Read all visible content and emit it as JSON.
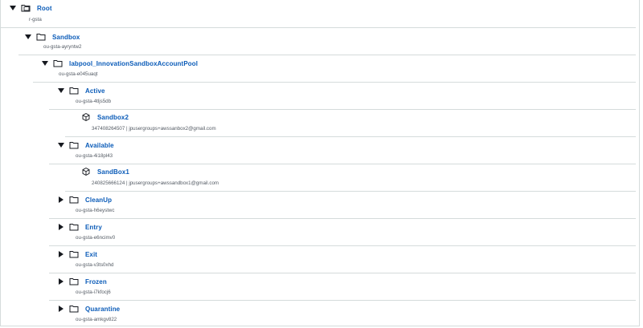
{
  "tree": {
    "root": {
      "name": "Root",
      "id": "r-gsta"
    },
    "sandbox": {
      "name": "Sandbox",
      "id": "ou-gsta-ayryntw2"
    },
    "labpool": {
      "name": "labpool_InnovationSandboxAccountPool",
      "id": "ou-gsta-e045uaqt"
    },
    "active": {
      "name": "Active",
      "id": "ou-gsta-4tljs5db"
    },
    "sandbox2": {
      "name": "Sandbox2",
      "detail": "347408264507 | jpusergroups+awssanbox2@gmail.com"
    },
    "available": {
      "name": "Available",
      "id": "ou-gsta-4i18pl43"
    },
    "sandbox1": {
      "name": "SandBox1",
      "detail": "240825666124 | jpusergroups+awssandbox1@gmail.com"
    },
    "cleanup": {
      "name": "CleanUp",
      "id": "ou-gsta-h6eystwc"
    },
    "entry": {
      "name": "Entry",
      "id": "ou-gsta-e6ncimv0"
    },
    "exit": {
      "name": "Exit",
      "id": "ou-gsta-v3ts0xhd"
    },
    "frozen": {
      "name": "Frozen",
      "id": "ou-gsta-i7kfocj6"
    },
    "quarantine": {
      "name": "Quarantine",
      "id": "ou-gsta-amkgv822"
    }
  },
  "icons": {
    "folder": "folder-icon",
    "account": "account-cube-icon"
  },
  "colors": {
    "link": "#0a5bb8",
    "text": "#16191f",
    "muted": "#545b64",
    "divider": "#d5dbdb"
  }
}
